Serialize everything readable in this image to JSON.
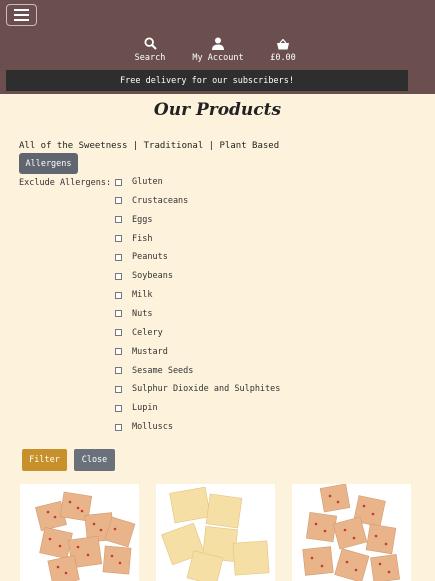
{
  "header": {
    "menu_icon": "hamburger-icon",
    "nav": [
      {
        "label": "Search",
        "icon": "search-icon"
      },
      {
        "label": "My Account",
        "icon": "user-icon"
      },
      {
        "label": "£0.00",
        "icon": "basket-icon"
      }
    ],
    "banner": "Free delivery for our subscribers!"
  },
  "main": {
    "title": "Our Products",
    "categories": [
      "All of the Sweetness",
      "Traditional",
      "Plant Based"
    ],
    "category_separator": " | ",
    "allergens_button": "Allergens",
    "exclude_label": "Exclude Allergens:",
    "allergens": [
      "Gluten",
      "Crustaceans",
      "Eggs",
      "Fish",
      "Peanuts",
      "Soybeans",
      "Milk",
      "Nuts",
      "Celery",
      "Mustard",
      "Sesame Seeds",
      "Sulphur Dioxide and Sulphites",
      "Lupin",
      "Molluscs"
    ],
    "filter_button": "Filter",
    "close_button": "Close"
  },
  "colors": {
    "header_bg": "#6b4f4f",
    "banner_bg": "#2e2e2e",
    "page_bg": "#fdf3dc",
    "filter_bg": "#c8902a",
    "close_bg": "#6b717a"
  },
  "products": [
    {
      "image": "fudge-with-red-sprinkles"
    },
    {
      "image": "plain-vanilla-fudge"
    },
    {
      "image": "fudge-with-red-sprinkles"
    }
  ]
}
